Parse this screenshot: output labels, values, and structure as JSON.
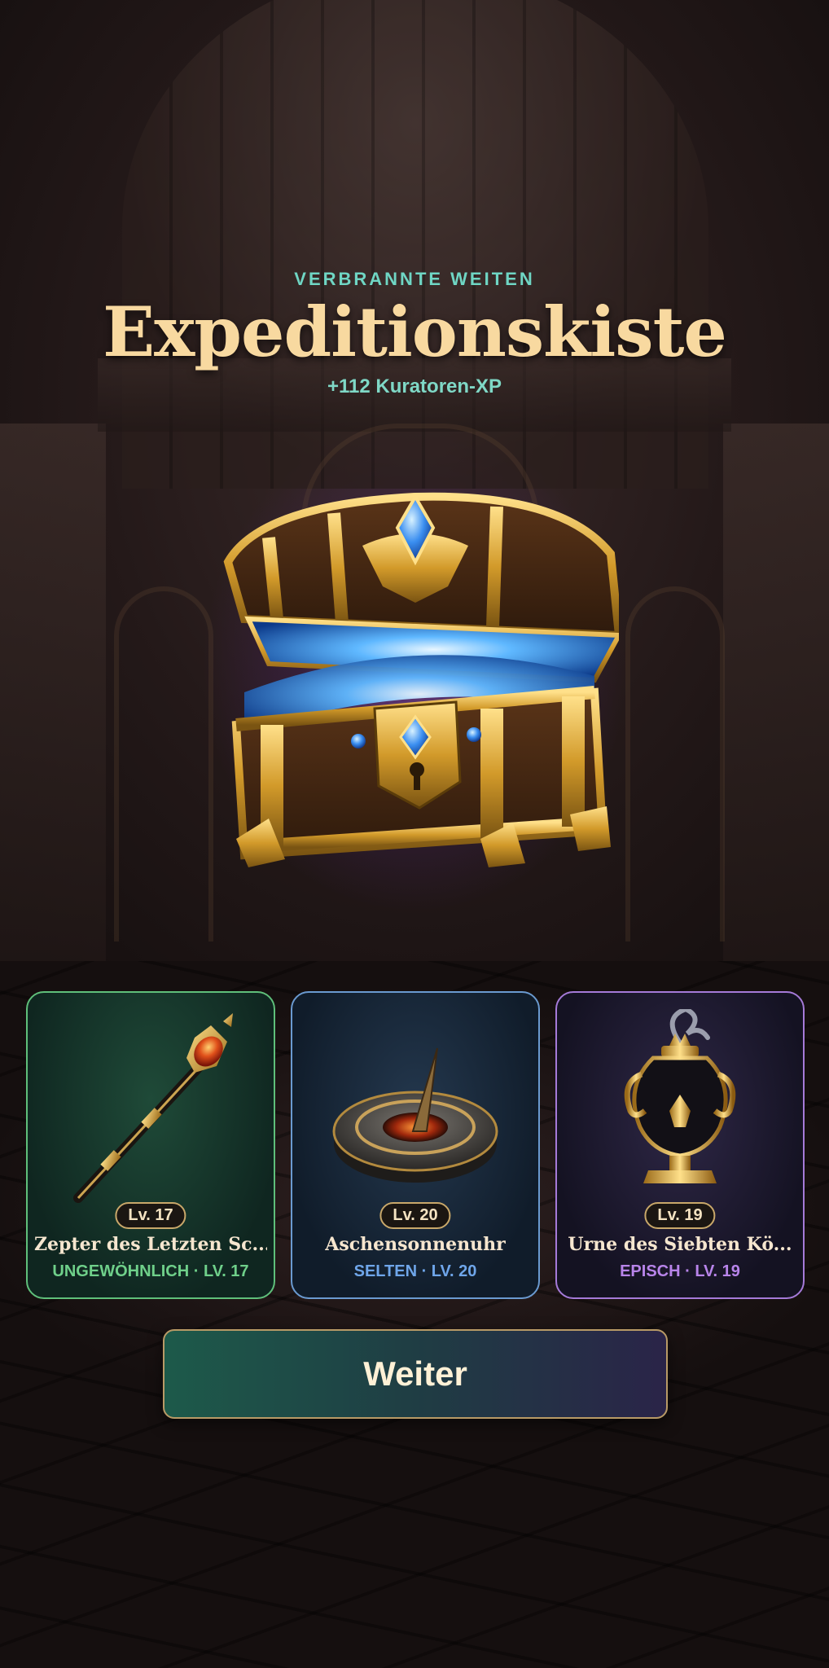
{
  "header": {
    "region": "VERBRANNTE WEITEN",
    "title": "Expeditionskiste",
    "xp": "+112 Kuratoren-XP"
  },
  "rewards": [
    {
      "level": "Lv. 17",
      "name": "Zepter des Letzten Sc...",
      "rarity": "UNGEWÖHNLICH · LV. 17",
      "icon": "scepter-icon",
      "color": "#5fbf7a"
    },
    {
      "level": "Lv. 20",
      "name": "Aschensonnenuhr",
      "rarity": "SELTEN · LV. 20",
      "icon": "sundial-icon",
      "color": "#6a9ad0"
    },
    {
      "level": "Lv. 19",
      "name": "Urne des Siebten Kö...",
      "rarity": "EPISCH · LV. 19",
      "icon": "urn-icon",
      "color": "#a57ad8"
    }
  ],
  "actions": {
    "continue_label": "Weiter"
  },
  "chest": {
    "icon": "treasure-chest-icon"
  }
}
